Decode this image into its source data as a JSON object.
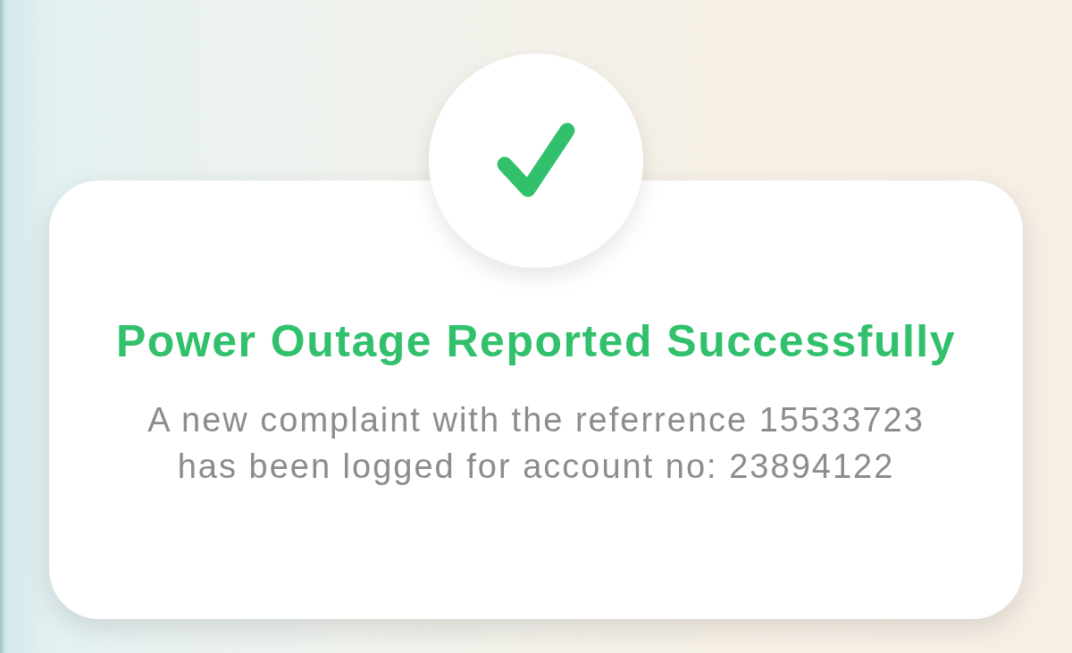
{
  "dialog": {
    "title": "Power Outage Reported Successfully",
    "message": "A new complaint with the referrence 15533723 has been logged for account no: 23894122"
  }
}
